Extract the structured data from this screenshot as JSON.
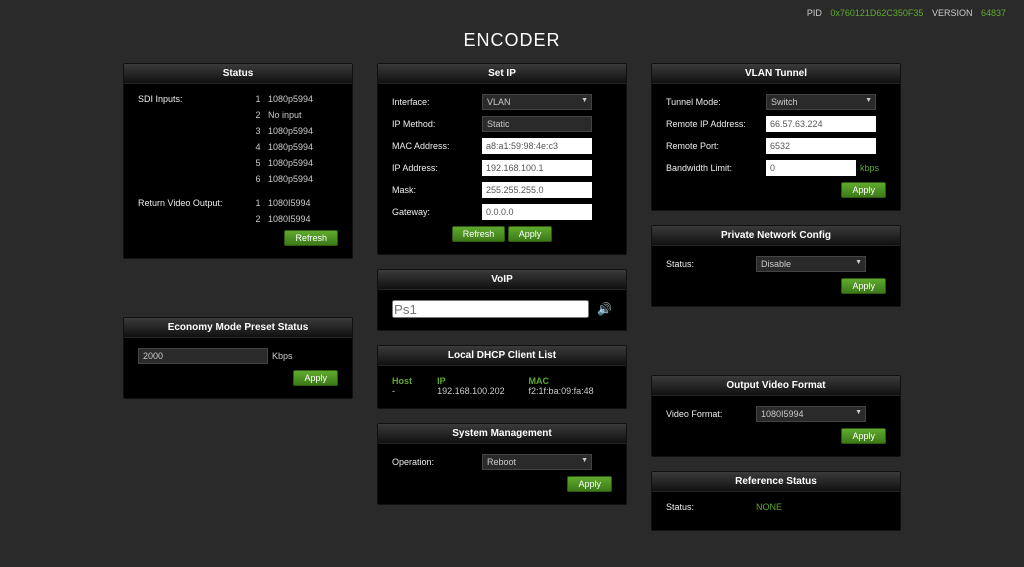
{
  "topbar": {
    "pid_label": "PID",
    "pid_value": "0x760121D62C350F35",
    "version_label": "VERSION",
    "version_value": "64837"
  },
  "title": "ENCODER",
  "status": {
    "header": "Status",
    "sdi_label": "SDI Inputs:",
    "sdi": [
      {
        "n": "1",
        "v": "1080p5994"
      },
      {
        "n": "2",
        "v": "No input"
      },
      {
        "n": "3",
        "v": "1080p5994"
      },
      {
        "n": "4",
        "v": "1080p5994"
      },
      {
        "n": "5",
        "v": "1080p5994"
      },
      {
        "n": "6",
        "v": "1080p5994"
      }
    ],
    "ret_label": "Return Video Output:",
    "ret": [
      {
        "n": "1",
        "v": "1080I5994"
      },
      {
        "n": "2",
        "v": "1080I5994"
      }
    ],
    "refresh": "Refresh"
  },
  "economy": {
    "header": "Economy Mode Preset Status",
    "value": "2000",
    "unit": "Kbps",
    "apply": "Apply"
  },
  "setip": {
    "header": "Set IP",
    "interface_label": "Interface:",
    "interface": "VLAN",
    "method_label": "IP Method:",
    "method": "Static",
    "mac_label": "MAC Address:",
    "mac": "a8:a1:59:98:4e:c3",
    "ip_label": "IP Address:",
    "ip": "192.168.100.1",
    "mask_label": "Mask:",
    "mask": "255.255.255.0",
    "gw_label": "Gateway:",
    "gw": "0.0.0.0",
    "refresh": "Refresh",
    "apply": "Apply"
  },
  "voip": {
    "header": "VoIP",
    "placeholder": "Ps1"
  },
  "dhcp": {
    "header": "Local DHCP Client List",
    "cols": {
      "host": "Host",
      "ip": "IP",
      "mac": "MAC"
    },
    "rows": [
      {
        "host": "-",
        "ip": "192.168.100.202",
        "mac": "f2:1f:ba:09:fa:48"
      }
    ]
  },
  "sys": {
    "header": "System Management",
    "op_label": "Operation:",
    "op": "Reboot",
    "apply": "Apply"
  },
  "vlan": {
    "header": "VLAN Tunnel",
    "mode_label": "Tunnel Mode:",
    "mode": "Switch",
    "rip_label": "Remote IP Address:",
    "rip": "66.57.63.224",
    "rport_label": "Remote Port:",
    "rport": "6532",
    "bw_label": "Bandwidth Limit:",
    "bw": "0",
    "bw_unit": "kbps",
    "apply": "Apply"
  },
  "priv": {
    "header": "Private Network Config",
    "status_label": "Status:",
    "status": "Disable",
    "apply": "Apply"
  },
  "outv": {
    "header": "Output Video Format",
    "label": "Video Format:",
    "value": "1080I5994",
    "apply": "Apply"
  },
  "ref": {
    "header": "Reference Status",
    "label": "Status:",
    "value": "NONE"
  }
}
